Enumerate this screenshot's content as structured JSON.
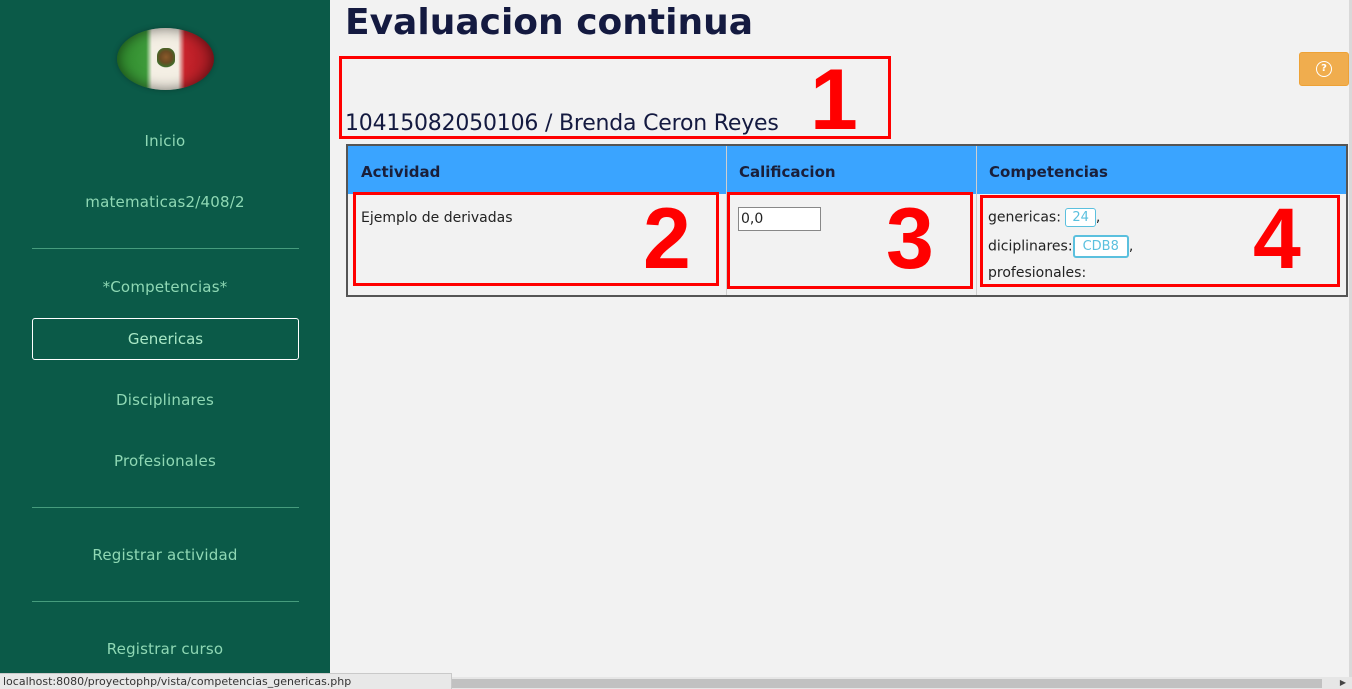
{
  "sidebar": {
    "logo_name": "mexican-flag",
    "links": {
      "inicio": "Inicio",
      "course": "matematicas2/408/2",
      "competencias_header": "*Competencias*",
      "genericas": "Genericas",
      "disciplinares": "Disciplinares",
      "profesionales": "Profesionales",
      "registrar_actividad": "Registrar actividad",
      "registrar_curso": "Registrar curso"
    }
  },
  "main": {
    "title": "Evaluacion continua",
    "student": "10415082050106 / Brenda Ceron Reyes",
    "help_icon": "question-circle-icon"
  },
  "table": {
    "headers": [
      "Actividad",
      "Calificacion",
      "Competencias"
    ],
    "row": {
      "actividad": "Ejemplo de derivadas",
      "calificacion": "0,0",
      "competencias": {
        "genericas_label": "genericas:",
        "genericas_badge": "24",
        "disciplinares_label": "diciplinares:",
        "disciplinares_badge": "CDB8",
        "profesionales_label": "profesionales:",
        "sep": ","
      }
    }
  },
  "annotations": [
    "1",
    "2",
    "3",
    "4"
  ],
  "status_bar": {
    "url": "localhost:8080/proyectophp/vista/competencias_genericas.php"
  },
  "colors": {
    "sidebar_bg": "#0b5a48",
    "header_bg": "#3aa4ff",
    "help_button": "#f0ad4e",
    "annotation": "#ff0000"
  }
}
